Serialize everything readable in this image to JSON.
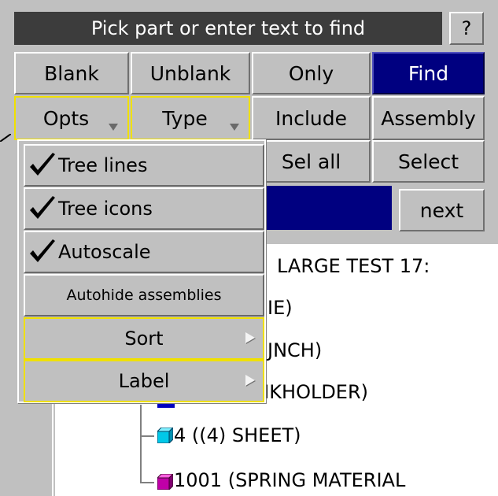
{
  "header": {
    "title": "Pick part or enter text to find",
    "help_label": "?"
  },
  "buttons": {
    "blank": "Blank",
    "unblank": "Unblank",
    "only": "Only",
    "find": "Find",
    "opts": "Opts",
    "type": "Type",
    "include": "Include",
    "assembly": "Assembly",
    "sel_all": "Sel all",
    "select": "Select",
    "next": "next"
  },
  "menu": {
    "items": [
      {
        "label": "Tree lines",
        "checked": true
      },
      {
        "label": "Tree icons",
        "checked": true
      },
      {
        "label": "Autoscale",
        "checked": true
      },
      {
        "label": "Autohide assemblies",
        "checked": false
      },
      {
        "label": "Sort",
        "submenu": true
      },
      {
        "label": "Label",
        "submenu": true
      }
    ]
  },
  "tree": {
    "rows": [
      {
        "text": "LARGE TEST 17:"
      },
      {
        "text": "IE)"
      },
      {
        "text": "JNCH)"
      },
      {
        "text": "(  )  LANKHOLDER)"
      },
      {
        "text": "4 ((4) SHEET)"
      },
      {
        "text": "1001 (SPRING MATERIAL"
      }
    ]
  },
  "colors": {
    "panel": "#c0c0c0",
    "titlebar": "#3c3c3c",
    "find_active": "#000080",
    "highlight_border": "#f0e000",
    "cube_blue": "#0000c0",
    "cube_cyan": "#00c8e8",
    "cube_magenta": "#c000a8"
  }
}
